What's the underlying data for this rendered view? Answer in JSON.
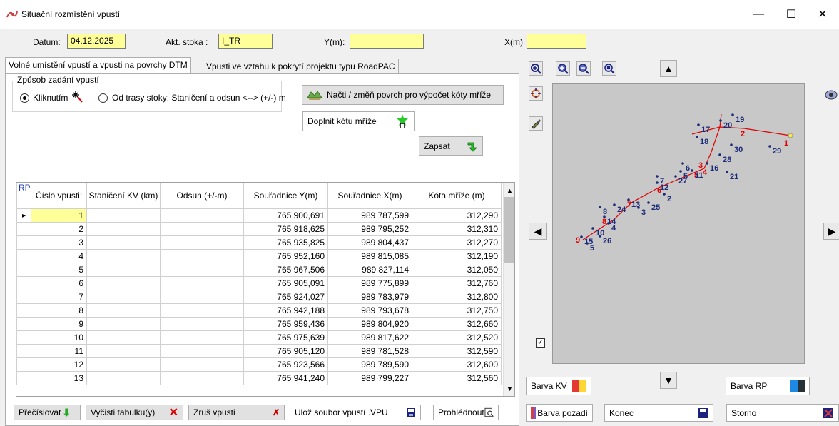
{
  "window": {
    "title": "Situační rozmístění vpustí",
    "controls": [
      "—",
      "☐",
      "✕"
    ]
  },
  "header": {
    "date_label": "Datum:",
    "date_value": "04.12.2025",
    "stoka_label": "Akt. stoka :",
    "stoka_value": "I_TR",
    "y_label": "Y(m):",
    "y_value": "",
    "x_label": "X(m)",
    "x_value": ""
  },
  "tabs": [
    {
      "label": "Volné umístění vpustí a vpusti na povrchy DTM",
      "active": true
    },
    {
      "label": "Vpusti ve vztahu k pokrytí projektu typu RoadPAC",
      "active": false
    }
  ],
  "mode_group": {
    "title": "Způsob zadání vpustí",
    "option_click": "Kliknutím",
    "option_route": "Od trasy stoky: Staničení a odsun <--> (+/-) m",
    "selected": "click"
  },
  "buttons": {
    "load_surface": "Načti / změň povrch pro výpočet kóty mříže",
    "fill_grate": "Doplnit kótu mříže",
    "write": "Zapsat",
    "renumber": "Přečíslovat",
    "clear_table": "Vyčisti tabulku(y)",
    "cancel_inlet": "Zruš vpusti",
    "save_file": "Ulož soubor vpustí .VPU",
    "browse": "Prohlédnout",
    "color_kv": "Barva KV",
    "color_rp": "Barva RP",
    "color_bg": "Barva pozadí",
    "end": "Konec",
    "storno": "Storno"
  },
  "table": {
    "columns": [
      "RP",
      "Číslo vpusti:",
      "Staničení KV (km)",
      "Odsun (+/-m)",
      "Souřadnice Y(m)",
      "Souřadnice X(m)",
      "Kóta mříže (m)"
    ],
    "rows": [
      [
        "1",
        "",
        "",
        "765 900,691",
        "989 787,599",
        "312,290"
      ],
      [
        "2",
        "",
        "",
        "765 918,625",
        "989 795,252",
        "312,310"
      ],
      [
        "3",
        "",
        "",
        "765 935,825",
        "989 804,437",
        "312,270"
      ],
      [
        "4",
        "",
        "",
        "765 952,160",
        "989 815,085",
        "312,190"
      ],
      [
        "5",
        "",
        "",
        "765 967,506",
        "989 827,114",
        "312,050"
      ],
      [
        "6",
        "",
        "",
        "765 905,091",
        "989 775,899",
        "312,760"
      ],
      [
        "7",
        "",
        "",
        "765 924,027",
        "989 783,979",
        "312,800"
      ],
      [
        "8",
        "",
        "",
        "765 942,188",
        "989 793,678",
        "312,750"
      ],
      [
        "9",
        "",
        "",
        "765 959,436",
        "989 804,920",
        "312,660"
      ],
      [
        "10",
        "",
        "",
        "765 975,639",
        "989 817,622",
        "312,520"
      ],
      [
        "11",
        "",
        "",
        "765 905,120",
        "989 781,528",
        "312,590"
      ],
      [
        "12",
        "",
        "",
        "765 923,566",
        "989 789,590",
        "312,600"
      ],
      [
        "13",
        "",
        "",
        "765 941,240",
        "989 799,227",
        "312,560"
      ]
    ]
  },
  "map": {
    "route_nodes": [
      "1",
      "2",
      "3",
      "4",
      "5",
      "6",
      "7",
      "8",
      "9"
    ],
    "inlet_labels": [
      "19",
      "20",
      "17",
      "18",
      "30",
      "29",
      "28",
      "16",
      "21",
      "27",
      "5",
      "11",
      "6",
      "12",
      "2",
      "7",
      "25",
      "13",
      "3",
      "24",
      "8",
      "14",
      "4",
      "10",
      "15",
      "5",
      "26"
    ],
    "checkbox_checked": true
  },
  "colors": {
    "field_yellow": "#ffff99",
    "route_red": "#e00000",
    "label_navy": "#1c2a7a",
    "map_bg": "#c8c8c8"
  }
}
